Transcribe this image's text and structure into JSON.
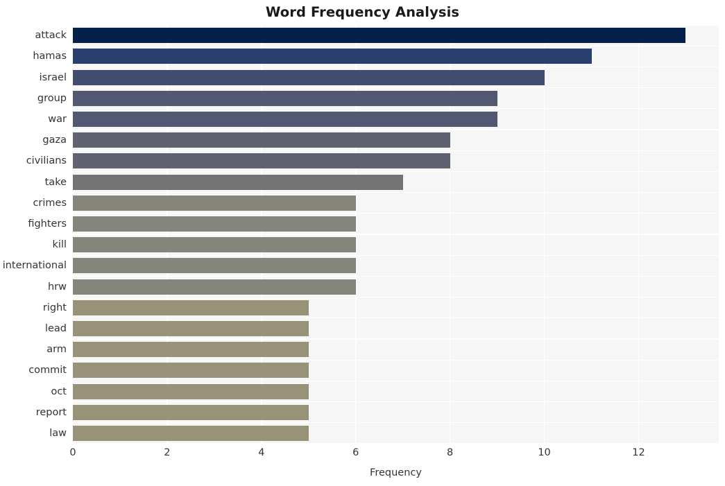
{
  "chart_data": {
    "type": "bar",
    "orientation": "horizontal",
    "title": "Word Frequency Analysis",
    "xlabel": "Frequency",
    "ylabel": "",
    "xlim": [
      0,
      13.7
    ],
    "xticks": [
      0,
      2,
      4,
      6,
      8,
      10,
      12
    ],
    "xticklabels": [
      "0",
      "2",
      "4",
      "6",
      "8",
      "10",
      "12"
    ],
    "grid": true,
    "grid_axis": "both",
    "legend": null,
    "categories": [
      "attack",
      "hamas",
      "israel",
      "group",
      "war",
      "gaza",
      "civilians",
      "take",
      "crimes",
      "fighters",
      "kill",
      "international",
      "hrw",
      "right",
      "lead",
      "arm",
      "commit",
      "oct",
      "report",
      "law"
    ],
    "values": [
      13,
      11,
      10,
      9,
      9,
      8,
      8,
      7,
      6,
      6,
      6,
      6,
      6,
      5,
      5,
      5,
      5,
      5,
      5,
      5
    ],
    "bar_colors": [
      "#04214a",
      "#293f6e",
      "#404c70",
      "#525872",
      "#525872",
      "#61626f",
      "#61626f",
      "#737373",
      "#86857c",
      "#86857c",
      "#86857c",
      "#86857c",
      "#86857c",
      "#989279",
      "#989279",
      "#989279",
      "#989279",
      "#989279",
      "#989279",
      "#989279"
    ],
    "plot_background": "#f6f6f6",
    "grid_color": "#ffffff",
    "figure_background": "#ffffff"
  }
}
